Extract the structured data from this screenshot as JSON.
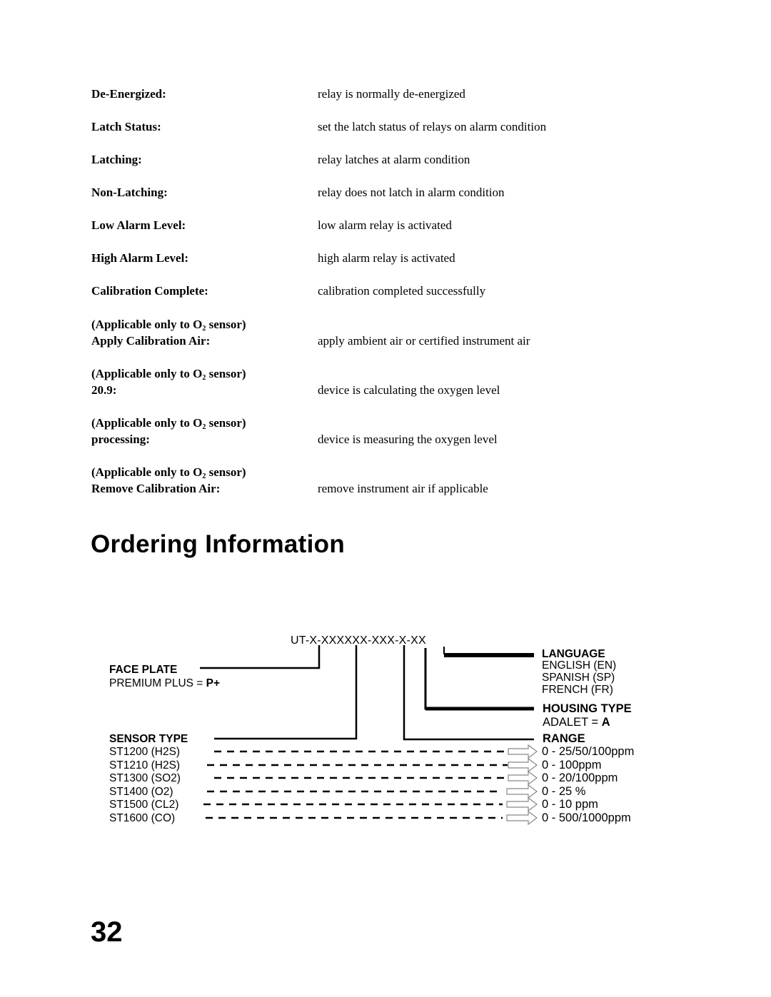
{
  "glossary": [
    {
      "term": "De-Energized:",
      "definition": "relay is normally de-energized"
    },
    {
      "term": "Latch Status:",
      "definition": "set the latch status of relays on alarm condition"
    },
    {
      "term": "Latching:",
      "definition": "relay latches at alarm condition"
    },
    {
      "term": "Non-Latching:",
      "definition": "relay does not latch in alarm condition"
    },
    {
      "term": "Low Alarm Level:",
      "definition": "low alarm relay is activated"
    },
    {
      "term": "High Alarm Level:",
      "definition": "high alarm relay is activated"
    },
    {
      "term": "Calibration Complete:",
      "definition": "calibration completed successfully"
    }
  ],
  "o2_note": {
    "prefix": "(Applicable only to O",
    "subscript": "2",
    "suffix": " sensor)"
  },
  "o2_glossary": [
    {
      "term": "Apply Calibration Air:",
      "definition": "apply ambient air or certified instrument air"
    },
    {
      "term": "20.9:",
      "definition": "device is calculating the oxygen level"
    },
    {
      "term": "processing:",
      "definition": "device is measuring the oxygen level"
    },
    {
      "term": "Remove Calibration Air:",
      "definition": "remove instrument air if applicable"
    }
  ],
  "section_title": "Ordering Information",
  "ordering": {
    "part_code": "UT-X-XXXXXX-XXX-X-XX",
    "face_plate": {
      "heading": "FACE PLATE",
      "option_label": "PREMIUM PLUS = ",
      "option_code": "P+"
    },
    "language": {
      "heading": "LANGUAGE",
      "options": [
        "ENGLISH (EN)",
        "SPANISH (SP)",
        "FRENCH (FR)"
      ]
    },
    "housing_type": {
      "heading": "HOUSING TYPE",
      "option_label": "ADALET = ",
      "option_code": "A"
    },
    "sensor_type": {
      "heading": "SENSOR TYPE",
      "options": [
        "ST1200 (H2S)",
        "ST1210 (H2S)",
        "ST1300 (SO2)",
        "ST1400 (O2)",
        "ST1500 (CL2)",
        "ST1600 (CO)"
      ]
    },
    "range": {
      "heading": "RANGE",
      "options": [
        "0 - 25/50/100ppm",
        "0 - 100ppm",
        "0 - 20/100ppm",
        "0 - 25 %",
        "0 - 10 ppm",
        "0 - 500/1000ppm"
      ]
    }
  },
  "page_number": "32"
}
